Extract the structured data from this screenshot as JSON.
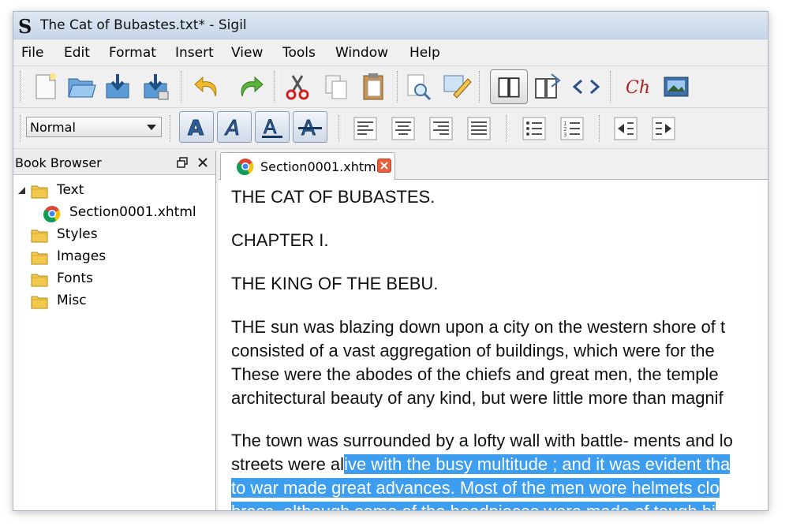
{
  "window": {
    "title": "The Cat of Bubastes.txt* - Sigil",
    "app_logo": "S"
  },
  "menubar": {
    "items": [
      "File",
      "Edit",
      "Format",
      "Insert",
      "View",
      "Tools",
      "Window",
      "Help"
    ]
  },
  "toolbar1": {
    "icons": [
      "new-file-icon",
      "open-file-icon",
      "save-icon",
      "save-as-icon",
      "undo-icon",
      "redo-icon",
      "cut-icon",
      "copy-icon",
      "paste-icon",
      "find-icon",
      "edit-meta-icon",
      "book-view-icon",
      "split-view-icon",
      "code-view-icon",
      "chapter-break-icon",
      "insert-image-icon"
    ]
  },
  "toolbar2": {
    "style_select": "Normal",
    "format_icons": [
      "bold-icon",
      "italic-icon",
      "underline-icon",
      "strikethrough-icon"
    ],
    "align_icons": [
      "align-left-icon",
      "align-center-icon",
      "align-right-icon",
      "justify-icon"
    ],
    "list_icons": [
      "bullet-list-icon",
      "numbered-list-icon"
    ],
    "indent_icons": [
      "decrease-indent-icon",
      "increase-indent-icon"
    ]
  },
  "sidebar": {
    "title": "Book Browser",
    "items": [
      {
        "label": "Text",
        "type": "folder"
      },
      {
        "label": "Section0001.xhtml",
        "type": "file"
      },
      {
        "label": "Styles",
        "type": "folder"
      },
      {
        "label": "Images",
        "type": "folder"
      },
      {
        "label": "Fonts",
        "type": "folder"
      },
      {
        "label": "Misc",
        "type": "folder"
      }
    ]
  },
  "editor": {
    "tab_label": "Section0001.xhtml",
    "heading1": "THE CAT OF BUBASTES.",
    "heading2": "CHAPTER I.",
    "heading3": "THE KING OF THE BEBU.",
    "para1": [
      "THE sun was blazing down upon a city on the western shore of t",
      "consisted of a vast aggregation of buildings, which were for the",
      "These were the abodes of the chiefs and great men, the temple",
      "architectural beauty of any kind, but were little more than magnif"
    ],
    "para2_line1": "The town was surrounded by a lofty wall with battle- ments and lo",
    "para2_line2_plain": "streets were al",
    "para2_line2_selected": "ive with the busy multitude ; and it was evident tha",
    "para2_line3_selected": "to war made great advances. Most of the men wore helmets clo",
    "para2_line4_selected": "brass, although some of the headpieces were made of tough hi"
  },
  "colors": {
    "selection": "#3d9ef0",
    "titlebar": "#c7d6e9"
  }
}
